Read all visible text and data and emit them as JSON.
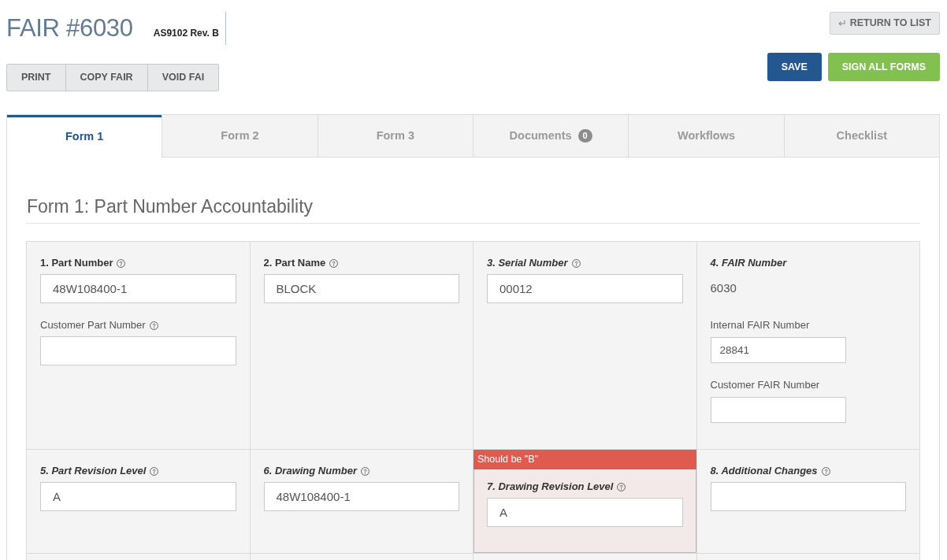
{
  "header": {
    "title": "FAIR #6030",
    "standard": "AS9102 Rev. B"
  },
  "toolbar_buttons": [
    "PRINT",
    "COPY FAIR",
    "VOID FAI"
  ],
  "return_button": {
    "icon": "↵",
    "label": "RETURN TO LIST"
  },
  "action_buttons": [
    {
      "kind": "primary",
      "label": "SAVE"
    },
    {
      "kind": "success",
      "label": "SIGN ALL FORMS"
    }
  ],
  "tabs": [
    {
      "label": "Form 1",
      "selected": true
    },
    {
      "label": "Form 2",
      "selected": false
    },
    {
      "label": "Form 3",
      "selected": false
    },
    {
      "label": "Documents",
      "selected": false,
      "badge": "0"
    },
    {
      "label": "Workflows",
      "selected": false
    },
    {
      "label": "Checklist",
      "selected": false
    }
  ],
  "form": {
    "title": "Form 1: Part Number Accountability",
    "rows": [
      {
        "cells": [
          {
            "items": [
              {
                "kind": "heading",
                "text": "1. Part Number",
                "italic": false,
                "help": true
              },
              {
                "kind": "input",
                "value": "48W108400-1"
              },
              {
                "kind": "sublabel",
                "text": "Customer Part Number",
                "help": true
              },
              {
                "kind": "input"
              }
            ]
          },
          {
            "items": [
              {
                "kind": "heading",
                "text": "2. Part Name",
                "italic": false,
                "help": true
              },
              {
                "kind": "input",
                "value": "BLOCK"
              }
            ]
          },
          {
            "items": [
              {
                "kind": "heading",
                "text": "3. Serial Number",
                "italic": true,
                "help": true
              },
              {
                "kind": "input",
                "value": "00012"
              }
            ]
          },
          {
            "items": [
              {
                "kind": "heading",
                "text": "4. FAIR Number",
                "italic": true,
                "help": false
              },
              {
                "kind": "text",
                "text": "6030"
              },
              {
                "kind": "sublabel",
                "text": "Internal FAIR Number",
                "help": false
              },
              {
                "kind": "small_input",
                "value": "28841"
              },
              {
                "kind": "sublabel",
                "text": "Customer FAIR Number",
                "help": false
              },
              {
                "kind": "small_input"
              }
            ]
          }
        ]
      },
      {
        "cells": [
          {
            "items": [
              {
                "kind": "heading",
                "text": "5. Part Revision Level",
                "italic": true,
                "help": true
              },
              {
                "kind": "input",
                "value": "A"
              }
            ]
          },
          {
            "items": [
              {
                "kind": "heading",
                "text": "6. Drawing Number",
                "italic": true,
                "help": true
              },
              {
                "kind": "input",
                "value": "48W108400-1"
              }
            ]
          },
          {
            "error": "Should be \"B\"",
            "items": [
              {
                "kind": "heading",
                "text": "7. Drawing Revision Level",
                "italic": true,
                "help": true
              },
              {
                "kind": "input",
                "value": "A"
              }
            ]
          },
          {
            "items": [
              {
                "kind": "heading",
                "text": "8. Additional Changes",
                "italic": true,
                "help": true
              },
              {
                "kind": "input"
              }
            ]
          }
        ]
      }
    ]
  }
}
